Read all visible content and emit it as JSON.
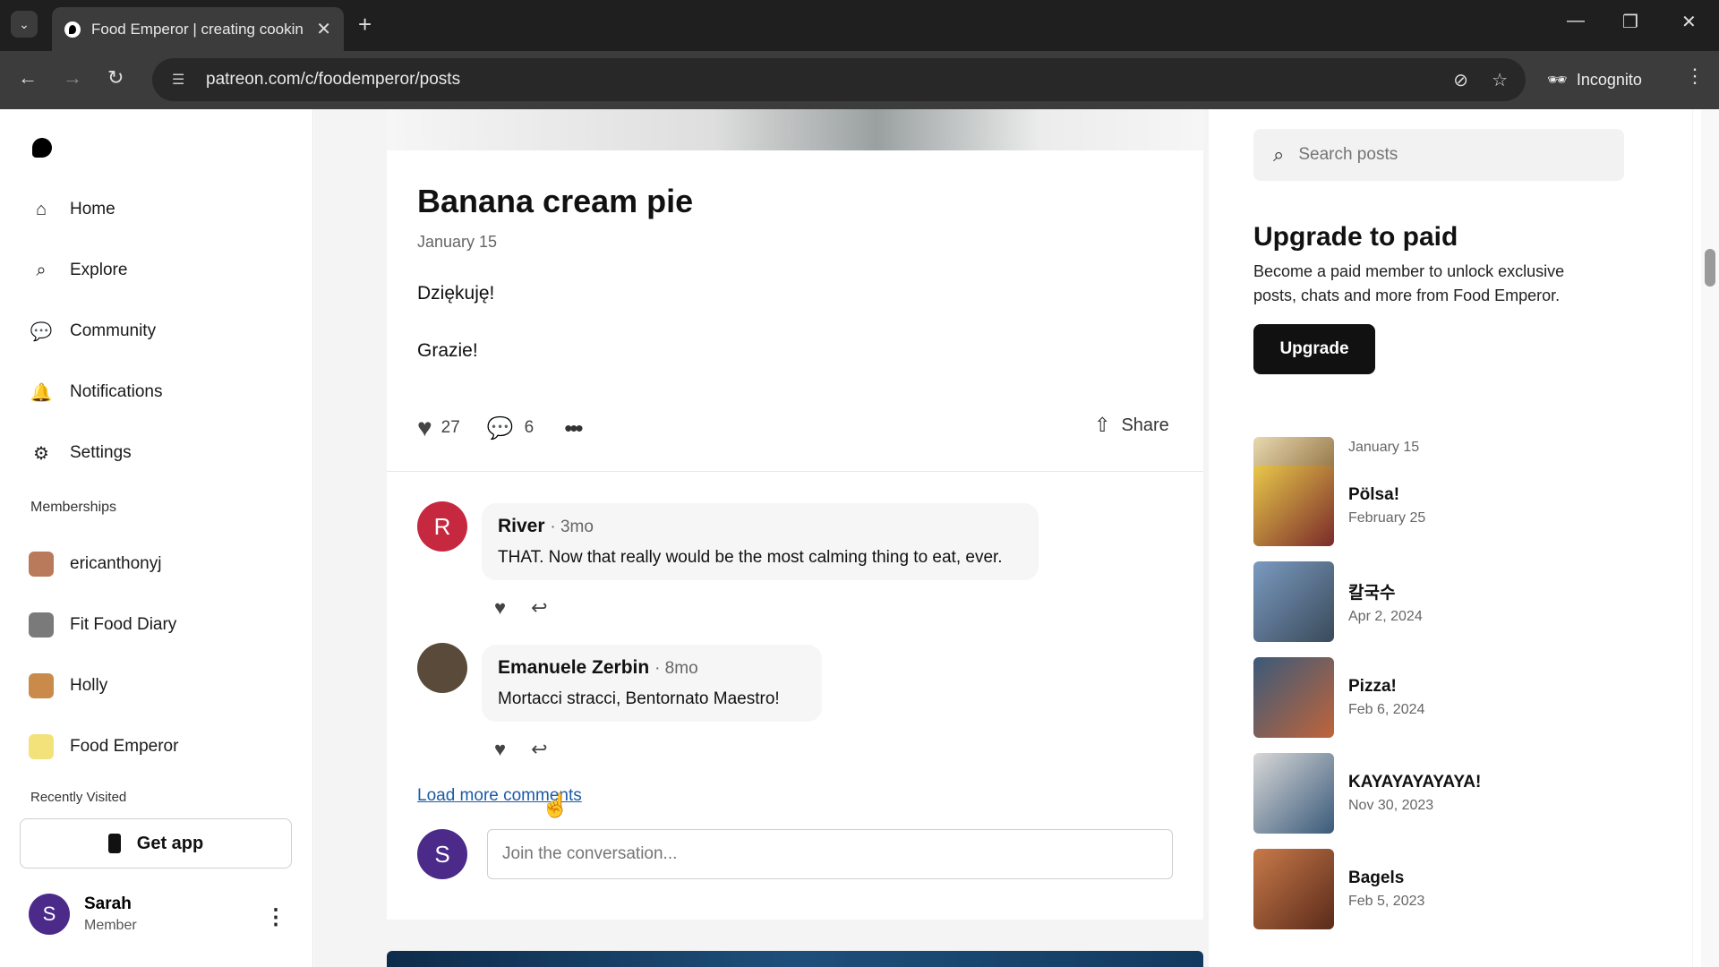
{
  "browser": {
    "tab_title": "Food Emperor | creating cookin",
    "url": "patreon.com/c/foodemperor/posts",
    "incognito_label": "Incognito"
  },
  "sidebar": {
    "nav": [
      {
        "label": "Home",
        "icon": "home-icon"
      },
      {
        "label": "Explore",
        "icon": "search-icon"
      },
      {
        "label": "Community",
        "icon": "chat-icon"
      },
      {
        "label": "Notifications",
        "icon": "bell-icon"
      },
      {
        "label": "Settings",
        "icon": "gear-icon"
      }
    ],
    "memberships_label": "Memberships",
    "memberships": [
      {
        "label": "ericanthonyj"
      },
      {
        "label": "Fit Food Diary"
      },
      {
        "label": "Holly"
      },
      {
        "label": "Food Emperor"
      }
    ],
    "recently_visited_label": "Recently Visited",
    "get_app_label": "Get app",
    "user": {
      "initial": "S",
      "name": "Sarah",
      "role": "Member"
    }
  },
  "post": {
    "title": "Banana cream pie",
    "date": "January 15",
    "body": [
      "Dziękuję!",
      "Grazie!"
    ],
    "likes": "27",
    "comments_count": "6",
    "share_label": "Share",
    "comments": [
      {
        "initial": "R",
        "name": "River",
        "time": "3mo",
        "text": "THAT. Now that really would be the most calming thing to eat, ever."
      },
      {
        "initial": "",
        "name": "Emanuele Zerbin",
        "time": "8mo",
        "text": "Mortacci stracci, Bentornato Maestro!"
      }
    ],
    "load_more_label": "Load more comments",
    "composer": {
      "initial": "S",
      "placeholder": "Join the conversation..."
    }
  },
  "right": {
    "search_placeholder": "Search posts",
    "upgrade": {
      "title": "Upgrade to paid",
      "desc": "Become a paid member to unlock exclusive posts, chats and more from Food Emperor.",
      "button": "Upgrade"
    },
    "recent_posts": [
      {
        "title": "",
        "date": "January 15",
        "color": "#c9a36a"
      },
      {
        "title": "Pölsa!",
        "date": "February 25",
        "color": "#b86a3a"
      },
      {
        "title": "칼국수",
        "date": "Apr 2, 2024",
        "color": "#6f8aa8"
      },
      {
        "title": "Pizza!",
        "date": "Feb 6, 2024",
        "color": "#c0643a"
      },
      {
        "title": "KAYAYAYAYAYA!",
        "date": "Nov 30, 2023",
        "color": "#5d7a96"
      },
      {
        "title": "Bagels",
        "date": "Feb 5, 2023",
        "color": "#a4553a"
      }
    ]
  }
}
